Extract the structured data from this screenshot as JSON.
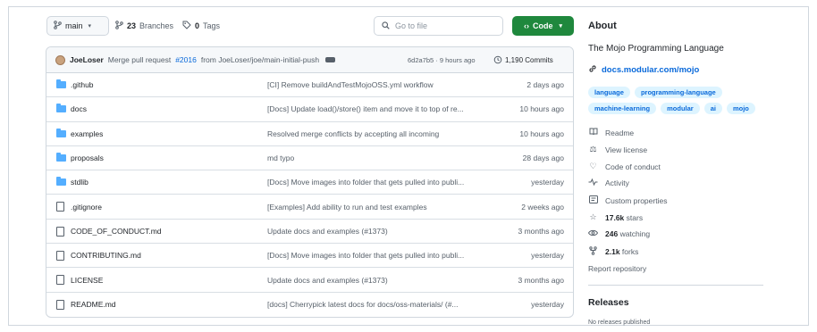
{
  "toolbar": {
    "branch": "main",
    "branches_count": "23",
    "branches_label": "Branches",
    "tags_count": "0",
    "tags_label": "Tags",
    "search_placeholder": "Go to file",
    "code_label": "Code"
  },
  "commit": {
    "author": "JoeLoser",
    "message_pre": "Merge pull request",
    "pr": "#2016",
    "message_post": "from JoeLoser/joe/main-initial-push",
    "sha": "6d2a7b5",
    "time": "9 hours ago",
    "commits_count": "1,190 Commits"
  },
  "files": [
    {
      "name": ".github",
      "type": "folder",
      "message": "[CI] Remove buildAndTestMojoOSS.yml workflow",
      "age": "2 days ago"
    },
    {
      "name": "docs",
      "type": "folder",
      "message": "[Docs] Update load()/store() item and move it to top of re...",
      "age": "10 hours ago"
    },
    {
      "name": "examples",
      "type": "folder",
      "message": "Resolved merge conflicts by accepting all incoming",
      "age": "10 hours ago"
    },
    {
      "name": "proposals",
      "type": "folder",
      "message": "md typo",
      "age": "28 days ago"
    },
    {
      "name": "stdlib",
      "type": "folder",
      "message": "[Docs] Move images into folder that gets pulled into publi...",
      "age": "yesterday"
    },
    {
      "name": ".gitignore",
      "type": "file",
      "message": "[Examples] Add ability to run and test examples",
      "age": "2 weeks ago"
    },
    {
      "name": "CODE_OF_CONDUCT.md",
      "type": "file",
      "message": "Update docs and examples (#1373)",
      "age": "3 months ago"
    },
    {
      "name": "CONTRIBUTING.md",
      "type": "file",
      "message": "[Docs] Move images into folder that gets pulled into publi...",
      "age": "yesterday"
    },
    {
      "name": "LICENSE",
      "type": "file",
      "message": "Update docs and examples (#1373)",
      "age": "3 months ago"
    },
    {
      "name": "README.md",
      "type": "file",
      "message": "[docs] Cherrypick latest docs for docs/oss-materials/ (#...",
      "age": "yesterday"
    }
  ],
  "about": {
    "heading": "About",
    "description": "The Mojo Programming Language",
    "website": "docs.modular.com/mojo",
    "topics": [
      "language",
      "programming-language",
      "machine-learning",
      "modular",
      "ai",
      "mojo"
    ],
    "readme": "Readme",
    "license": "View license",
    "conduct": "Code of conduct",
    "activity": "Activity",
    "custom_props": "Custom properties",
    "stars_count": "17.6k",
    "stars_label": "stars",
    "watching_count": "246",
    "watching_label": "watching",
    "forks_count": "2.1k",
    "forks_label": "forks",
    "report": "Report repository"
  },
  "releases": {
    "heading": "Releases",
    "none": "No releases published"
  }
}
